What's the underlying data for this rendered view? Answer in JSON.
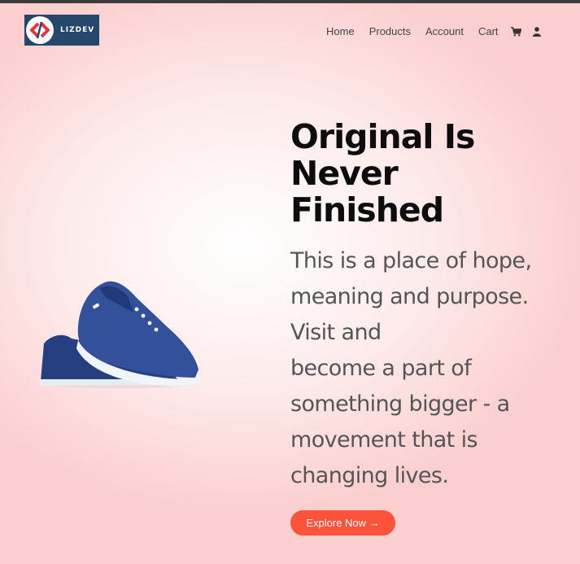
{
  "brand": {
    "name": "LIZDEV"
  },
  "nav": {
    "items": [
      {
        "label": "Home"
      },
      {
        "label": "Products"
      },
      {
        "label": "Account"
      },
      {
        "label": "Cart"
      }
    ],
    "icons": [
      "shopping-cart-icon",
      "user-icon"
    ]
  },
  "hero": {
    "title": "Original Is\nNever\nFinished",
    "description": "This is a place of hope,\nmeaning and purpose.\nVisit and\nbecome a part of\nsomething bigger - a\nmovement that is\nchanging lives.",
    "cta_label": "Explore Now →"
  },
  "colors": {
    "accent": "#ff523b",
    "logo_bg": "#24476b",
    "background": "#fbcfcf"
  }
}
